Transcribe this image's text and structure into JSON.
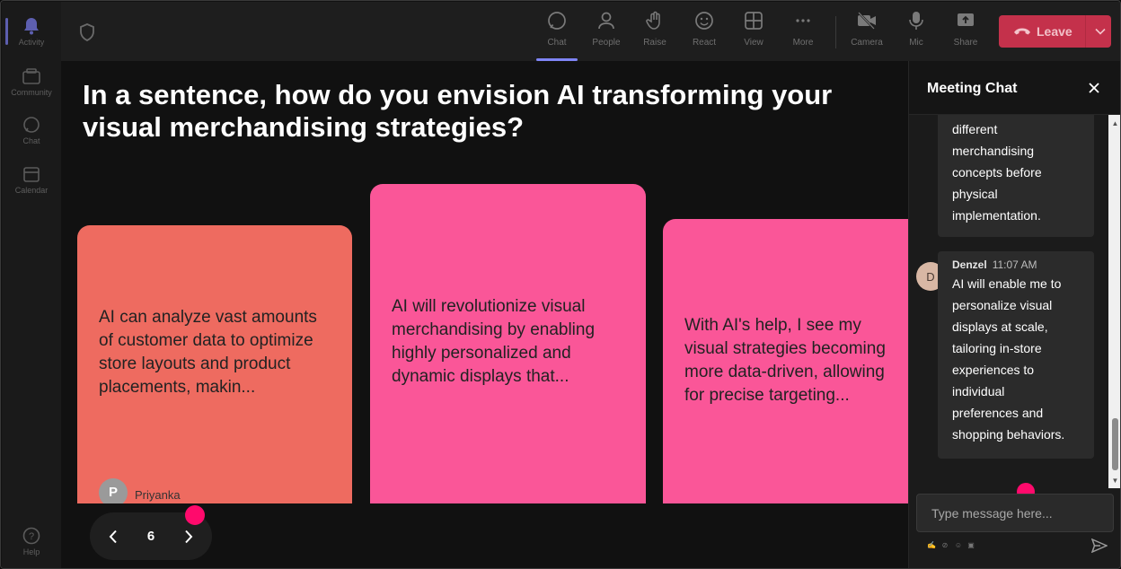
{
  "rail": {
    "items": [
      {
        "label": "Activity",
        "icon": "bell-icon",
        "active": true
      },
      {
        "label": "Community",
        "icon": "community-icon"
      },
      {
        "label": "Chat",
        "icon": "chat-icon"
      },
      {
        "label": "Calendar",
        "icon": "calendar-icon"
      },
      {
        "label": "Help",
        "icon": "help-icon"
      }
    ]
  },
  "toolbar": {
    "chat": "Chat",
    "people": "People",
    "raise": "Raise",
    "react": "React",
    "view": "View",
    "more": "More",
    "camera": "Camera",
    "mic": "Mic",
    "share": "Share",
    "leave": "Leave"
  },
  "stage": {
    "question": "In a sentence, how do you envision AI transforming your visual merchandising strategies?",
    "cards": [
      {
        "text": "AI can analyze vast amounts of customer data to optimize store layouts and product placements, makin...",
        "author_initial": "P",
        "author": "Priyanka",
        "color": "#ee6b60"
      },
      {
        "text": "AI will revolutionize visual merchandising by enabling highly personalized and dynamic displays that...",
        "color": "#fa5698"
      },
      {
        "text": "With AI's help, I see my visual strategies becoming more data-driven, allowing for precise targeting...",
        "color": "#fa5698"
      }
    ],
    "page_number": "6"
  },
  "chat": {
    "title": "Meeting Chat",
    "messages": [
      {
        "text_lines": [
          "different",
          "merchandising",
          "concepts before",
          "physical",
          "implementation."
        ]
      },
      {
        "sender": "Denzel",
        "avatar_initial": "D",
        "time": "11:07 AM",
        "text_lines": [
          "AI will enable me to",
          "personalize visual",
          "displays at scale,",
          "tailoring in-store",
          "experiences to",
          "individual",
          "preferences and",
          "shopping behaviors."
        ]
      }
    ],
    "placeholder": "Type message here..."
  },
  "colors": {
    "leave": "#c4314b",
    "accent": "#7f85f5",
    "cursor_dot": "#ff0a6c"
  }
}
